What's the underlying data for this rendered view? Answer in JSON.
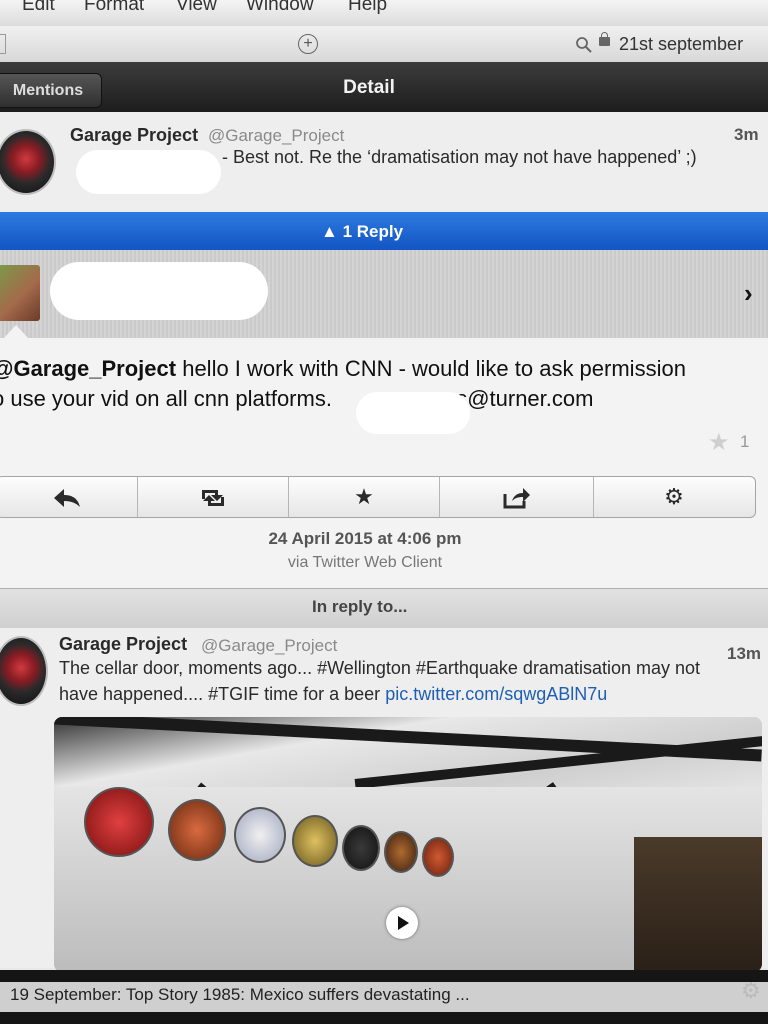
{
  "menu": [
    "Edit",
    "Format",
    "View",
    "Window",
    "Help"
  ],
  "address_bar": {
    "date": "21st september"
  },
  "nav": {
    "back_label": "Mentions",
    "title": "Detail"
  },
  "tweet1": {
    "name": "Garage Project",
    "handle": "@Garage_Project",
    "time": "3m",
    "text": "- Best not. Re the ‘dramatisation may not have happened’ ;)"
  },
  "reply_bar": {
    "label": "1 Reply"
  },
  "tweet2": {
    "mention": "@Garage_Project",
    "text_line1": " hello I work with CNN - would like to ask permission",
    "text_line2": "o use your vid on all cnn platforms.",
    "email_tail": "os@turner.com",
    "fav_count": "1",
    "timestamp": "24 April 2015 at 4:06 pm",
    "via": "via Twitter Web Client"
  },
  "in_reply_to": {
    "label": "In reply to..."
  },
  "tweet3": {
    "name": "Garage Project",
    "handle": "@Garage_Project",
    "time": "13m",
    "text_line1": "The cellar door, moments ago... #Wellington #Earthquake dramatisation may not",
    "text_line2": "have happened.... #TGIF time for a beer ",
    "link": "pic.twitter.com/sqwgABlN7u"
  },
  "ticker": {
    "text": "19 September: Top Story 1985: Mexico suffers devastating ..."
  }
}
